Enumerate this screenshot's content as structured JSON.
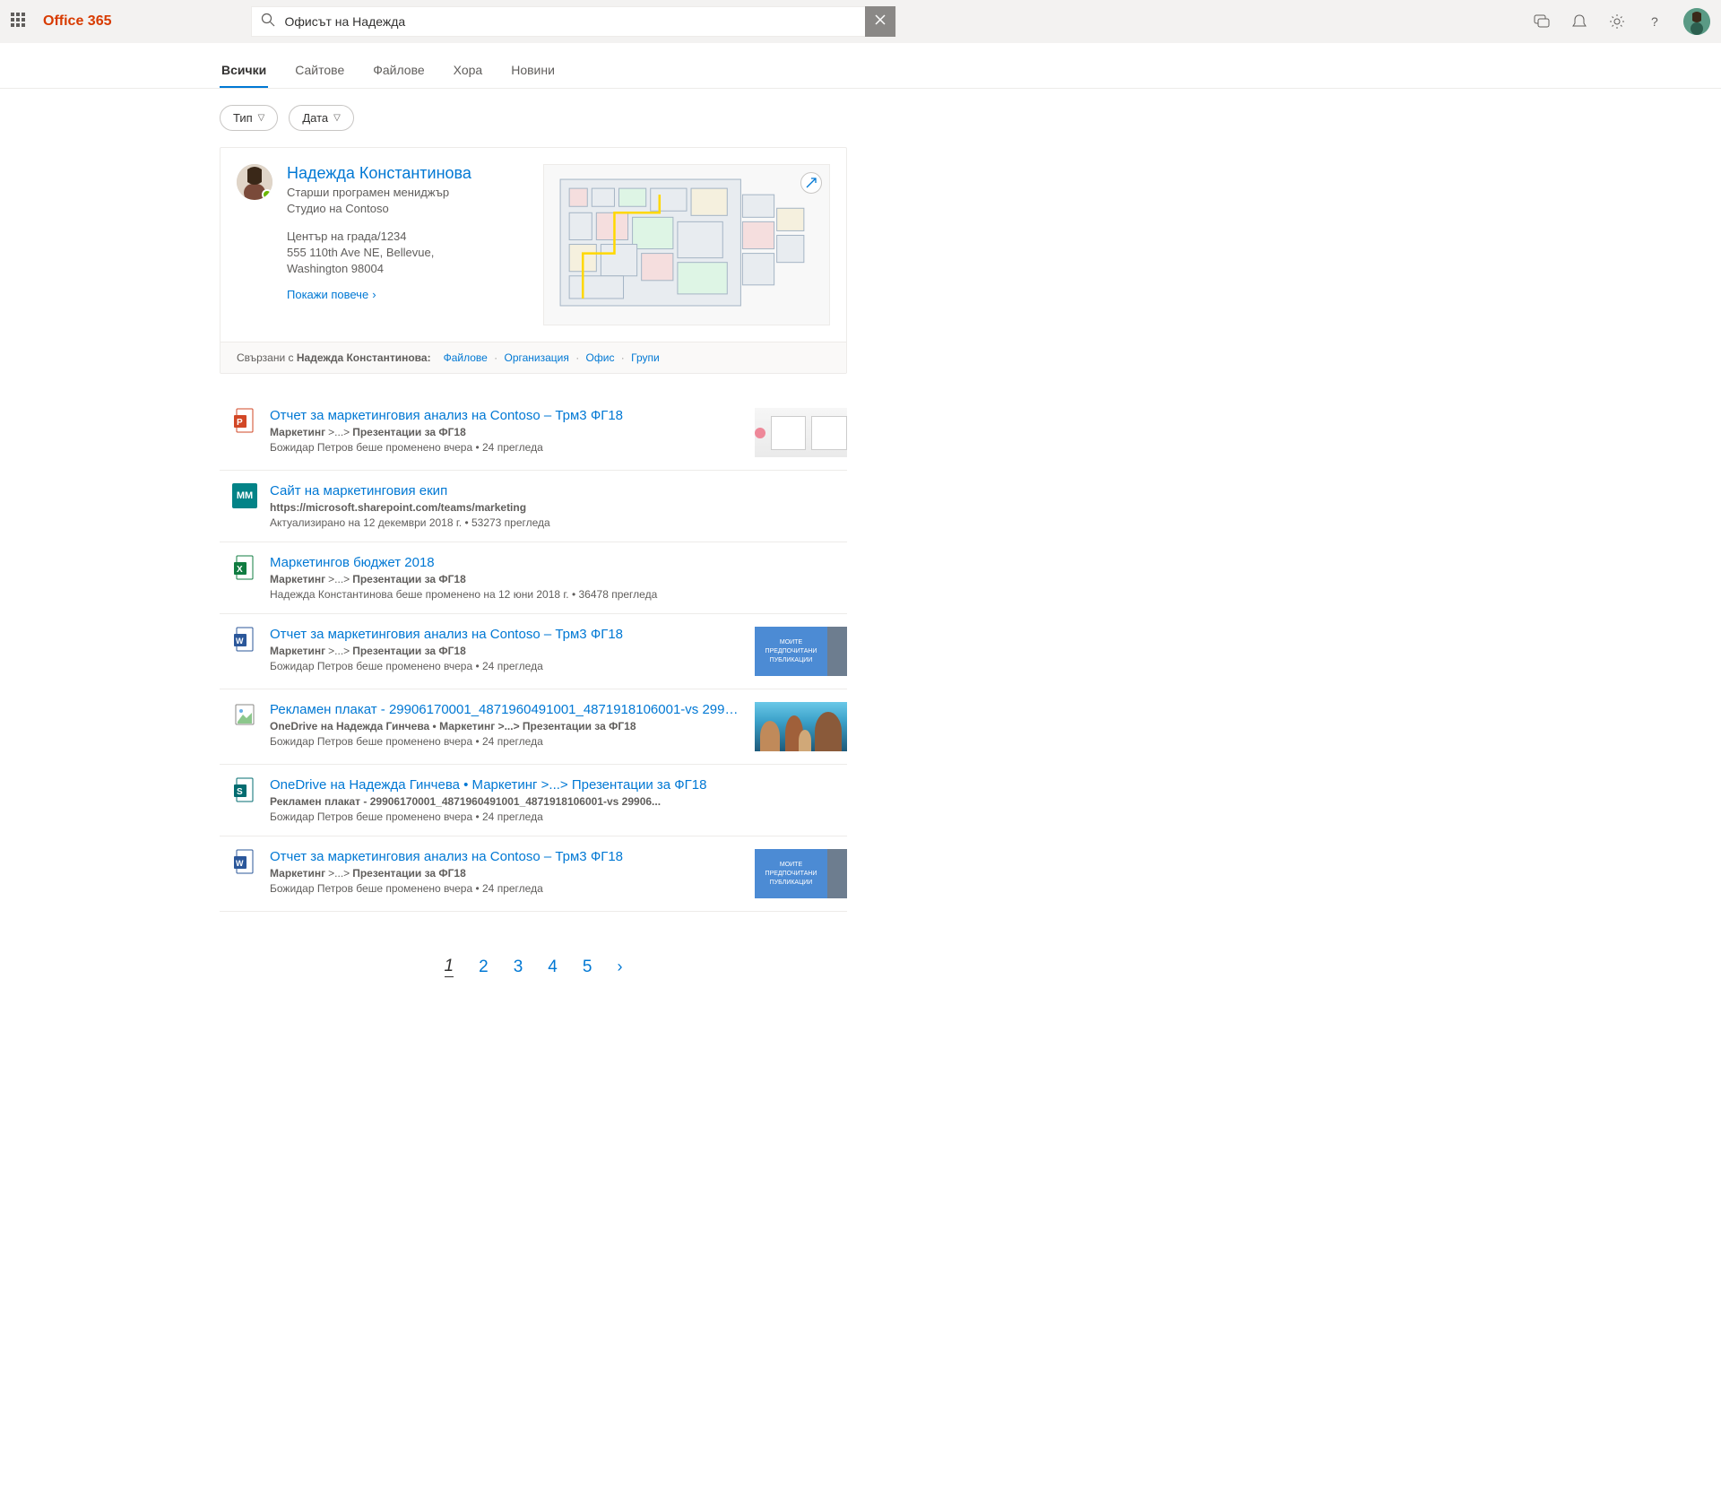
{
  "header": {
    "brand": "Office 365",
    "search_value": "Офисът на Надежда"
  },
  "tabs": {
    "items": [
      {
        "label": "Всички",
        "active": true
      },
      {
        "label": "Сайтове"
      },
      {
        "label": "Файлове"
      },
      {
        "label": "Хора"
      },
      {
        "label": "Новини"
      }
    ]
  },
  "filters": {
    "type": "Тип",
    "date": "Дата"
  },
  "person": {
    "name": "Надежда Константинова",
    "title": "Старши програмен мениджър",
    "studio": "Студио на Contoso",
    "addr1": "Център на града/1234",
    "addr2": "555 110th Ave NE, Bellevue,",
    "addr3": "Washington 98004",
    "show_more": "Покажи повече"
  },
  "related": {
    "prefix_a": "Свързани с ",
    "prefix_b": "Надежда Константинова:",
    "links": [
      "Файлове",
      "Организация",
      "Офис",
      "Групи"
    ]
  },
  "results": [
    {
      "icon": "powerpoint",
      "title": "Отчет за маркетинговия анализ на Contoso – Трм3 ФГ18",
      "bc_a": "Маркетинг",
      "bc_b": "Презентации за ФГ18",
      "meta": "Божидар Петров беше променено вчера  •  24 прегледа",
      "thumb": "pres"
    },
    {
      "icon": "mm",
      "title": "Сайт на маркетинговия екип",
      "sub": "https://microsoft.sharepoint.com/teams/marketing",
      "meta": "Актуализирано на 12 декември 2018 г.  •  53273 прегледа"
    },
    {
      "icon": "excel",
      "title": "Маркетингов бюджет 2018",
      "bc_a": "Маркетинг",
      "bc_b": "Презентации за ФГ18",
      "meta": "Надежда Константинова беше променено на 12 юни 2018 г.  •  36478 прегледа"
    },
    {
      "icon": "word",
      "title": "Отчет за маркетинговия анализ на Contoso – Трм3 ФГ18",
      "bc_a": "Маркетинг",
      "bc_b": "Презентации за ФГ18",
      "meta": "Божидар Петров беше променено вчера  •  24 прегледа",
      "thumb": "word",
      "thumb_l1": "МОИТЕ",
      "thumb_l2": "ПРЕДПОЧИТАНИ",
      "thumb_l3": "ПУБЛИКАЦИИ"
    },
    {
      "icon": "image",
      "title": "Рекламен плакат - 29906170001_4871960491001_4871918106001-vs 29906...",
      "sub": "OneDrive на Надежда Гинчева  •  Маркетинг  >...>  Презентации за ФГ18",
      "meta": "Божидар Петров беше променено вчера  •  24 прегледа",
      "thumb": "moana"
    },
    {
      "icon": "sharepoint",
      "title_a": "OneDrive на Надежда Гинчева  •  ",
      "title_b": "Маркетинг  >...>  Презентации за ФГ18",
      "sub": "Рекламен плакат - 29906170001_4871960491001_4871918106001-vs 29906...",
      "meta": "Божидар Петров беше променено вчера  •  24 прегледа"
    },
    {
      "icon": "word",
      "title": "Отчет за маркетинговия анализ на Contoso – Трм3 ФГ18",
      "bc_a": "Маркетинг",
      "bc_b": "Презентации за ФГ18",
      "meta": "Божидар Петров беше променено вчера  •  24 прегледа",
      "thumb": "word",
      "thumb_l1": "МОИТЕ",
      "thumb_l2": "ПРЕДПОЧИТАНИ",
      "thumb_l3": "ПУБЛИКАЦИИ"
    }
  ],
  "pagination": {
    "pages": [
      "1",
      "2",
      "3",
      "4",
      "5"
    ],
    "current": "1"
  }
}
